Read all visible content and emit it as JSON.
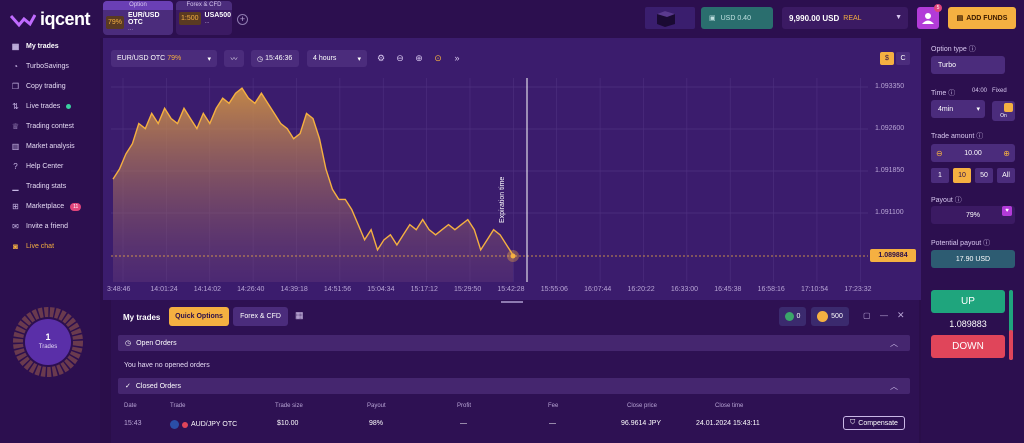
{
  "brand": {
    "name": "iqcent"
  },
  "tabs": [
    {
      "category": "Option",
      "badge": "79%",
      "name": "EUR/USD OTC",
      "sub": "..."
    },
    {
      "category": "Forex & CFD",
      "badge": "1:500",
      "name": "USA500",
      "sub": "..."
    }
  ],
  "header": {
    "usd_chip": "USD 0.40",
    "balance": "9,990.00 USD",
    "account": "REAL",
    "profile_badge": "5",
    "add_funds": "ADD FUNDS"
  },
  "sidebar": {
    "items": [
      {
        "label": "My trades",
        "icon": "grid-icon"
      },
      {
        "label": "TurboSavings",
        "icon": "piggy-icon"
      },
      {
        "label": "Copy trading",
        "icon": "copy-icon"
      },
      {
        "label": "Live trades",
        "icon": "arrows-icon"
      },
      {
        "label": "Trading contest",
        "icon": "trophy-icon"
      },
      {
        "label": "Market analysis",
        "icon": "chart-icon"
      },
      {
        "label": "Help Center",
        "icon": "help-icon"
      },
      {
        "label": "Trading stats",
        "icon": "stats-icon"
      },
      {
        "label": "Marketplace",
        "icon": "cart-icon",
        "badge": "11"
      },
      {
        "label": "Invite a friend",
        "icon": "invite-icon"
      },
      {
        "label": "Live chat",
        "icon": "chat-icon"
      }
    ],
    "donut": {
      "count": "1",
      "label": "Trades"
    }
  },
  "toolbar": {
    "asset": "EUR/USD OTC",
    "asset_payout": "79%",
    "time": "15:46:36",
    "interval": "4 hours",
    "currency_a": "$",
    "currency_b": "C"
  },
  "chart_data": {
    "type": "area",
    "y_ticks": [
      "1.093350",
      "1.092600",
      "1.091850",
      "1.091100"
    ],
    "x_ticks": [
      "3:48:46",
      "14:01:24",
      "14:14:02",
      "14:26:40",
      "14:39:18",
      "14:51:56",
      "15:04:34",
      "15:17:12",
      "15:29:50",
      "15:42:28",
      "15:55:06",
      "16:07:44",
      "16:20:22",
      "16:33:00",
      "16:45:38",
      "16:58:16",
      "17:10:54",
      "17:23:32"
    ],
    "current_price": "1.089884",
    "expiration_label": "Expiration time",
    "ylim": [
      1.08988,
      1.0934
    ],
    "values": [
      1.0914,
      1.0916,
      1.0919,
      1.0921,
      1.0925,
      1.0924,
      1.0927,
      1.0925,
      1.0928,
      1.0926,
      1.0925,
      1.0928,
      1.0926,
      1.0924,
      1.0927,
      1.0925,
      1.0928,
      1.093,
      1.0929,
      1.0931,
      1.0932,
      1.093,
      1.0929,
      1.0931,
      1.0929,
      1.0927,
      1.0925,
      1.0924,
      1.0922,
      1.0923,
      1.0927,
      1.0926,
      1.0922,
      1.0916,
      1.0912,
      1.091,
      1.091,
      1.0908,
      1.0905,
      1.0902,
      1.0904,
      1.09,
      1.0902,
      1.0903,
      1.0901,
      1.0903,
      1.0905,
      1.0904,
      1.0906,
      1.0904,
      1.0903,
      1.0904,
      1.0905,
      1.0904,
      1.0905,
      1.0906,
      1.0904,
      1.09,
      1.0902,
      1.0904,
      1.0903,
      1.0901,
      1.0899
    ]
  },
  "trades": {
    "title": "My trades",
    "tab_quick": "Quick Options",
    "tab_forex": "Forex & CFD",
    "stat_a": "0",
    "stat_b": "500",
    "open_orders": "Open Orders",
    "no_orders": "You have no opened orders",
    "closed_orders": "Closed Orders",
    "columns": [
      "Date",
      "Trade",
      "Trade size",
      "Payout",
      "Profit",
      "Fee",
      "Close price",
      "Close time"
    ],
    "row": {
      "date": "15:43",
      "trade": "AUD/JPY OTC",
      "size": "$10.00",
      "payout": "98%",
      "profit": "—",
      "fee": "—",
      "close_price": "96.9614 JPY",
      "close_time": "24.01.2024 15:43:11"
    },
    "compensate": "Compensate"
  },
  "right": {
    "option_type_label": "Option type",
    "option_type": "Turbo",
    "time_label": "Time",
    "time_value": "04:00",
    "fixed_label": "Fixed",
    "duration": "4min",
    "toggle": "On",
    "amount_label": "Trade amount",
    "amount": "10.00",
    "quick_amounts": [
      "1",
      "10",
      "50",
      "All"
    ],
    "payout_label": "Payout",
    "payout": "79%",
    "potential_label": "Potential payout",
    "potential": "17.90 USD",
    "up": "UP",
    "price": "1.089883",
    "down": "DOWN"
  },
  "colors": {
    "accent": "#f5b041",
    "up": "#1fa57d",
    "down": "#e0455a",
    "bg": "#2a0e4a"
  }
}
